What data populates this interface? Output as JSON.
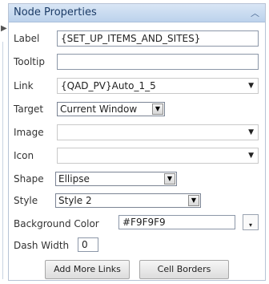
{
  "panel": {
    "title": "Node Properties",
    "collapse_icon": "chevron-up-icon"
  },
  "fields": {
    "label": {
      "label": "Label",
      "value": "{SET_UP_ITEMS_AND_SITES}"
    },
    "tooltip": {
      "label": "Tooltip",
      "value": ""
    },
    "link": {
      "label": "Link",
      "value": "{QAD_PV}Auto_1_5"
    },
    "target": {
      "label": "Target",
      "value": "Current Window"
    },
    "image": {
      "label": "Image",
      "value": ""
    },
    "icon": {
      "label": "Icon",
      "value": ""
    },
    "shape": {
      "label": "Shape",
      "value": "Ellipse"
    },
    "style": {
      "label": "Style",
      "value": "Style 2"
    },
    "background_color": {
      "label": "Background Color",
      "value": "#F9F9F9"
    },
    "dash_width": {
      "label": "Dash Width",
      "value": "0"
    }
  },
  "buttons": {
    "add_more_links": "Add More Links",
    "cell_borders": "Cell Borders"
  },
  "colors": {
    "titlebar_top": "#d9e6f5",
    "titlebar_bottom": "#bcd2ec",
    "title_text": "#1b3b66"
  }
}
